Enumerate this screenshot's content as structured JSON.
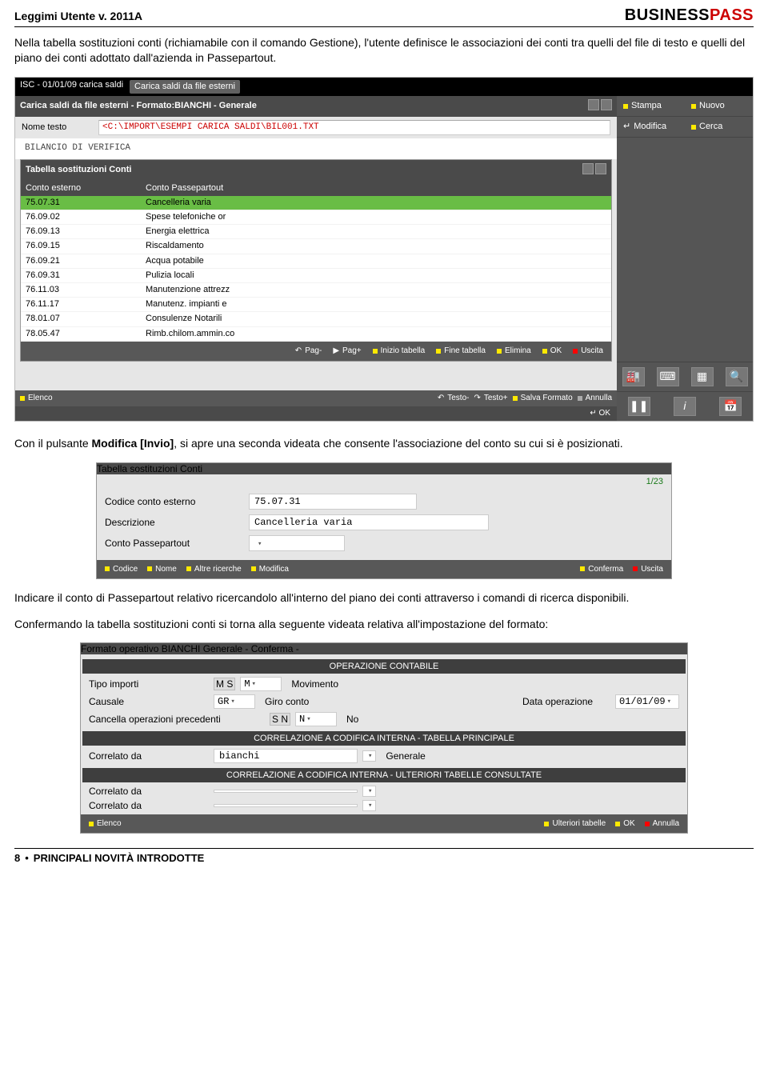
{
  "doc_title": "Leggimi Utente v. 2011A",
  "brand_business": "BUSINESS",
  "brand_pass": "PASS",
  "paragraph1": "Nella tabella sostituzioni conti (richiamabile con il comando Gestione), l'utente definisce le associazioni dei conti tra quelli del file di testo e quelli del piano dei conti adottato dall'azienda in Passepartout.",
  "paragraph2_a": "Con il pulsante ",
  "paragraph2_b": "Modifica [Invio]",
  "paragraph2_c": ", si apre una seconda videata che consente l'associazione del conto su cui si è posizionati.",
  "paragraph3": "Indicare il conto di Passepartout relativo ricercandolo all'interno del piano dei conti attraverso i comandi di ricerca disponibili.",
  "paragraph4": "Confermando la tabella sostituzioni conti si torna alla seguente videata relativa all'impostazione del formato:",
  "shot1": {
    "context_line": "ISC - 01/01/09 carica saldi",
    "context_tab": "Carica saldi da file esterni",
    "main_title": "Carica saldi da file esterni - Formato:BIANCHI - Generale",
    "nome_lab": "Nome testo",
    "nome_val": "<C:\\IMPORT\\ESEMPI CARICA SALDI\\BIL001.TXT",
    "bil_line": "BILANCIO DI VERIFICA",
    "sub_title": "Tabella sostituzioni Conti",
    "col1": "Conto esterno",
    "col2": "Conto Passepartout",
    "rows": [
      {
        "code": "75.07.31",
        "desc": "Cancelleria varia"
      },
      {
        "code": "76.09.02",
        "desc": "Spese telefoniche or"
      },
      {
        "code": "76.09.13",
        "desc": "Energia elettrica"
      },
      {
        "code": "76.09.15",
        "desc": "Riscaldamento"
      },
      {
        "code": "76.09.21",
        "desc": "Acqua potabile"
      },
      {
        "code": "76.09.31",
        "desc": "Pulizia locali"
      },
      {
        "code": "76.11.03",
        "desc": "Manutenzione attrezz"
      },
      {
        "code": "76.11.17",
        "desc": "Manutenz. impianti e"
      },
      {
        "code": "78.01.07",
        "desc": "Consulenze  Notarili"
      },
      {
        "code": "78.05.47",
        "desc": "Rimb.chilom.ammin.co"
      }
    ],
    "bbar_inner": [
      "Pag-",
      "Pag+",
      "Inizio tabella",
      "Fine tabella",
      "Elimina",
      "OK",
      "Uscita"
    ],
    "bbar_outer_left": "Elenco",
    "bbar_outer": [
      "Testo-",
      "Testo+",
      "Salva Formato",
      "Annulla"
    ],
    "okstrip": "↵ OK",
    "side": {
      "stampa": "Stampa",
      "nuovo": "Nuovo",
      "modifica": "Modifica",
      "cerca": "Cerca"
    }
  },
  "shot2": {
    "title": "Tabella sostituzioni Conti",
    "counter": "1/23",
    "fields": {
      "codice_lab": "Codice conto esterno",
      "codice_val": "75.07.31",
      "descr_lab": "Descrizione",
      "descr_val": "Cancelleria varia",
      "conto_lab": "Conto Passepartout",
      "conto_val": ""
    },
    "bbar_left": [
      "Codice",
      "Nome",
      "Altre ricerche",
      "Modifica"
    ],
    "bbar_right": [
      "Conferma",
      "Uscita"
    ]
  },
  "shot3": {
    "title": "Formato operativo BIANCHI  Generale - Conferma -",
    "sec1": "OPERAZIONE CONTABILE",
    "tipo_lab": "Tipo importi",
    "tipo_chips": "M S",
    "tipo_val": "M",
    "tipo_txt": "Movimento",
    "caus_lab": "Causale",
    "caus_val": "GR",
    "caus_txt": "Giro conto",
    "data_lab": "Data operazione",
    "data_val": "01/01/09",
    "canc_lab": "Cancella operazioni precedenti",
    "canc_chips": "S N",
    "canc_val": "N",
    "canc_txt": "No",
    "sec2": "CORRELAZIONE A CODIFICA INTERNA - TABELLA PRINCIPALE",
    "corr_lab": "Correlato da",
    "corr_val": "bianchi",
    "corr_txt": "Generale",
    "sec3": "CORRELAZIONE A CODIFICA INTERNA - ULTERIORI TABELLE CONSULTATE",
    "bbar_left": "Elenco",
    "bbar_right": [
      "Ulteriori tabelle",
      "OK",
      "Annulla"
    ]
  },
  "footer": {
    "page": "8",
    "dot": "•",
    "section": "PRINCIPALI NOVITÀ INTRODOTTE"
  }
}
